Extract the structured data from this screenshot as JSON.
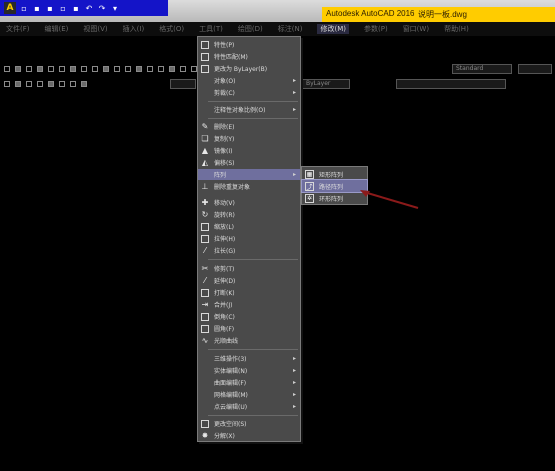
{
  "titlebar": {
    "app_title": "Autodesk AutoCAD 2016",
    "file_name": "说明一板.dwg"
  },
  "menubar": {
    "items": [
      {
        "label": "文件(F)"
      },
      {
        "label": "编辑(E)"
      },
      {
        "label": "视图(V)"
      },
      {
        "label": "插入(I)"
      },
      {
        "label": "格式(O)"
      },
      {
        "label": "工具(T)"
      },
      {
        "label": "绘图(D)"
      },
      {
        "label": "标注(N)"
      },
      {
        "label": "修改(M)"
      },
      {
        "label": "参数(P)"
      },
      {
        "label": "窗口(W)"
      },
      {
        "label": "帮助(H)"
      }
    ]
  },
  "toolbar": {
    "style_dropdown": "Standard",
    "layer_dropdown": "ByLayer"
  },
  "modify_menu": {
    "items": [
      {
        "label": "特性(P)",
        "icon": "properties-icon"
      },
      {
        "label": "特性匹配(M)",
        "icon": "match-properties-icon"
      },
      {
        "label": "更改为 ByLayer(B)",
        "icon": "bylayer-icon"
      },
      {
        "label": "对象(O)",
        "submenu": true
      },
      {
        "label": "剪裁(C)",
        "submenu": true
      },
      {
        "label": "注释性对象比例(O)",
        "submenu": true
      },
      {
        "label": "删除(E)",
        "icon": "erase-icon"
      },
      {
        "label": "复制(Y)",
        "icon": "copy-icon"
      },
      {
        "label": "镜像(I)",
        "icon": "mirror-icon"
      },
      {
        "label": "偏移(S)",
        "icon": "offset-icon"
      },
      {
        "label": "阵列",
        "submenu": true,
        "highlighted": true
      },
      {
        "label": "删除重复对象",
        "icon": "overkill-icon"
      },
      {
        "label": "移动(V)",
        "icon": "move-icon"
      },
      {
        "label": "旋转(R)",
        "icon": "rotate-icon"
      },
      {
        "label": "缩放(L)",
        "icon": "scale-icon"
      },
      {
        "label": "拉伸(H)",
        "icon": "stretch-icon"
      },
      {
        "label": "拉长(G)",
        "icon": "lengthen-icon"
      },
      {
        "label": "修剪(T)",
        "icon": "trim-icon"
      },
      {
        "label": "延伸(D)",
        "icon": "extend-icon"
      },
      {
        "label": "打断(K)",
        "icon": "break-icon"
      },
      {
        "label": "合并(J)",
        "icon": "join-icon"
      },
      {
        "label": "倒角(C)",
        "icon": "chamfer-icon"
      },
      {
        "label": "圆角(F)",
        "icon": "fillet-icon"
      },
      {
        "label": "光顺曲线",
        "icon": "blend-curves-icon"
      },
      {
        "label": "三维操作(3)",
        "submenu": true
      },
      {
        "label": "实体编辑(N)",
        "submenu": true
      },
      {
        "label": "曲面编辑(F)",
        "submenu": true
      },
      {
        "label": "网格编辑(M)",
        "submenu": true
      },
      {
        "label": "点云编辑(U)",
        "submenu": true
      },
      {
        "label": "更改空间(S)",
        "icon": "change-space-icon"
      },
      {
        "label": "分解(X)",
        "icon": "explode-icon"
      }
    ]
  },
  "array_submenu": {
    "items": [
      {
        "label": "矩形阵列",
        "icon": "rectangular-array-icon"
      },
      {
        "label": "路径阵列",
        "icon": "path-array-icon",
        "highlighted": true
      },
      {
        "label": "环形阵列",
        "icon": "polar-array-icon"
      }
    ]
  },
  "colors": {
    "highlight": "#6f6f9e",
    "menu_bg": "#4a4a4a",
    "canvas_bg": "#000000",
    "title_accent": "#ffcc00",
    "qat_blue": "#1414c8",
    "pointer_red": "#8b1a1a"
  }
}
